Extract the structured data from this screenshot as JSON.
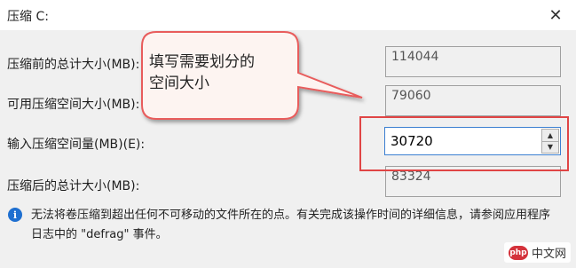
{
  "window": {
    "title": "压缩 C:",
    "close_symbol": "✕"
  },
  "fields": [
    {
      "label": "压缩前的总计大小(MB):",
      "value": "114044"
    },
    {
      "label": "可用压缩空间大小(MB):",
      "value": "79060"
    },
    {
      "label": "输入压缩空间量(MB)(E):",
      "value": "30720"
    },
    {
      "label": "压缩后的总计大小(MB):",
      "value": "83324"
    }
  ],
  "spinner": {
    "up_symbol": "▲",
    "down_symbol": "▼"
  },
  "callout": {
    "line1": "填写需要划分的",
    "line2": "空间大小",
    "color": "#e85c5c"
  },
  "highlight_color": "#e04545",
  "info": {
    "icon": "info-icon",
    "text": "无法将卷压缩到超出任何不可移动的文件所在的点。有关完成该操作时间的详细信息，请参阅应用程序日志中的 \"defrag\" 事件。"
  },
  "watermark": {
    "logo": "php",
    "text": "中文网"
  }
}
